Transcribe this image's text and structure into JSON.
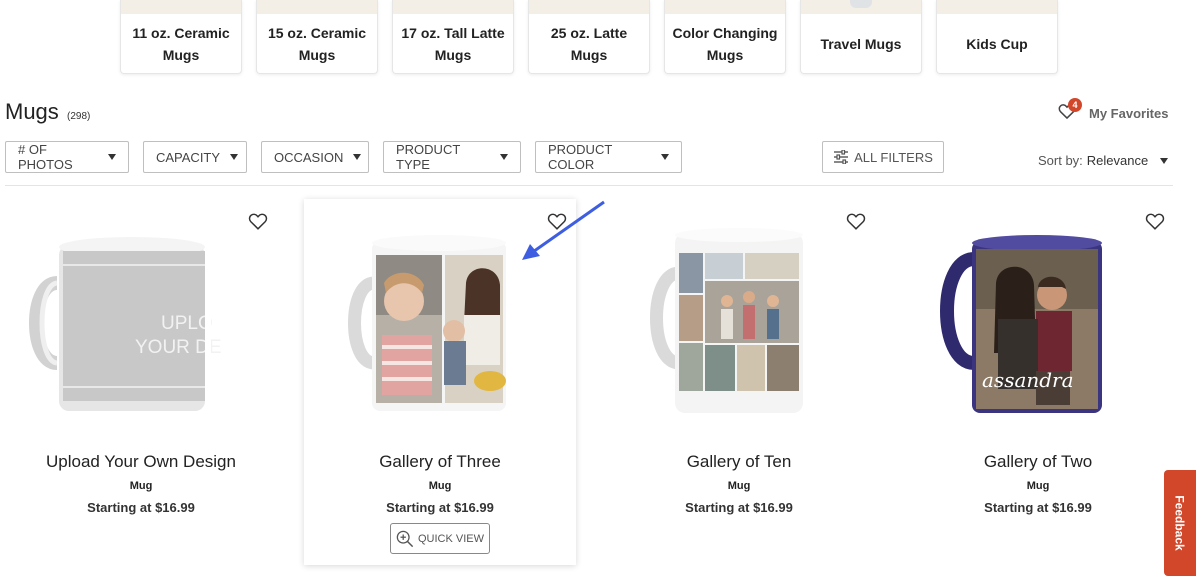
{
  "categories": [
    {
      "line1": "11 oz. Ceramic",
      "line2": "Mugs"
    },
    {
      "line1": "15 oz. Ceramic",
      "line2": "Mugs"
    },
    {
      "line1": "17 oz. Tall Latte",
      "line2": "Mugs"
    },
    {
      "line1": "25 oz. Latte",
      "line2": "Mugs"
    },
    {
      "line1": "Color Changing",
      "line2": "Mugs"
    },
    {
      "line1": "Travel Mugs",
      "line2": ""
    },
    {
      "line1": "Kids Cup",
      "line2": ""
    }
  ],
  "header": {
    "title": "Mugs",
    "count": "(298)",
    "favorites_label": "My Favorites",
    "favorites_badge": "4"
  },
  "filters": [
    "# OF PHOTOS",
    "CAPACITY",
    "OCCASION",
    "PRODUCT TYPE",
    "PRODUCT COLOR"
  ],
  "all_filters_label": "ALL FILTERS",
  "sort": {
    "label": "Sort by:",
    "value": "Relevance"
  },
  "products": [
    {
      "name": "Upload Your Own Design",
      "type": "Mug",
      "price": "Starting at $16.99",
      "art_text_1": "UPLO",
      "art_text_2": "YOUR DE"
    },
    {
      "name": "Gallery of Three",
      "type": "Mug",
      "price": "Starting at $16.99",
      "quick_view": "QUICK VIEW"
    },
    {
      "name": "Gallery of Ten",
      "type": "Mug",
      "price": "Starting at $16.99"
    },
    {
      "name": "Gallery of Two",
      "type": "Mug",
      "price": "Starting at $16.99",
      "art_text_1": "assandra"
    }
  ],
  "feedback_label": "Feedback",
  "colors": {
    "accent": "#d2462a",
    "arrow": "#3d5ee0",
    "mug_handle_dark": "#2f2a6e"
  }
}
